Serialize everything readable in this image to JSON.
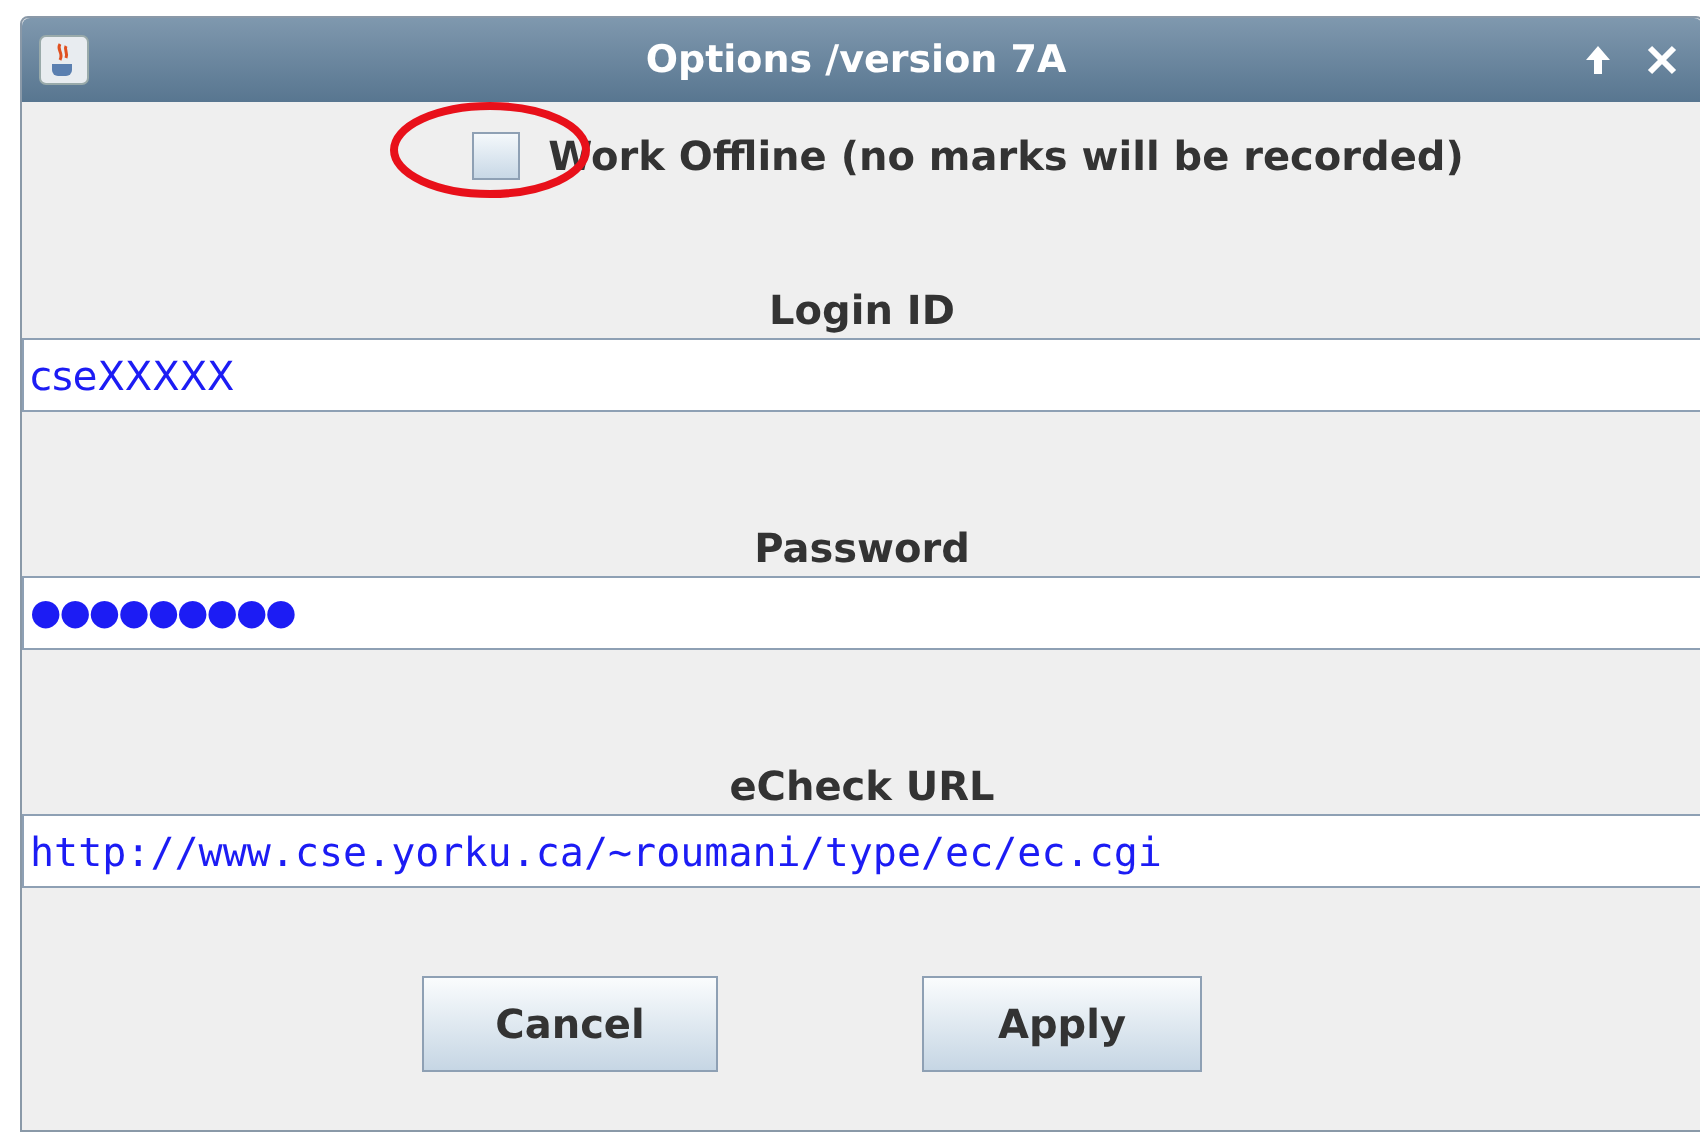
{
  "window": {
    "title": "Options /version 7A"
  },
  "offline": {
    "label": "Work Offline (no marks will be recorded)",
    "checked": false
  },
  "fields": [
    {
      "label": "Login ID",
      "value": "cseXXXXX",
      "kind": "text"
    },
    {
      "label": "Password",
      "value": "●●●●●●●●●",
      "kind": "password"
    },
    {
      "label": "eCheck URL",
      "value": "http://www.cse.yorku.ca/~roumani/type/ec/ec.cgi",
      "kind": "url"
    }
  ],
  "buttons": [
    "Cancel",
    "Apply"
  ]
}
